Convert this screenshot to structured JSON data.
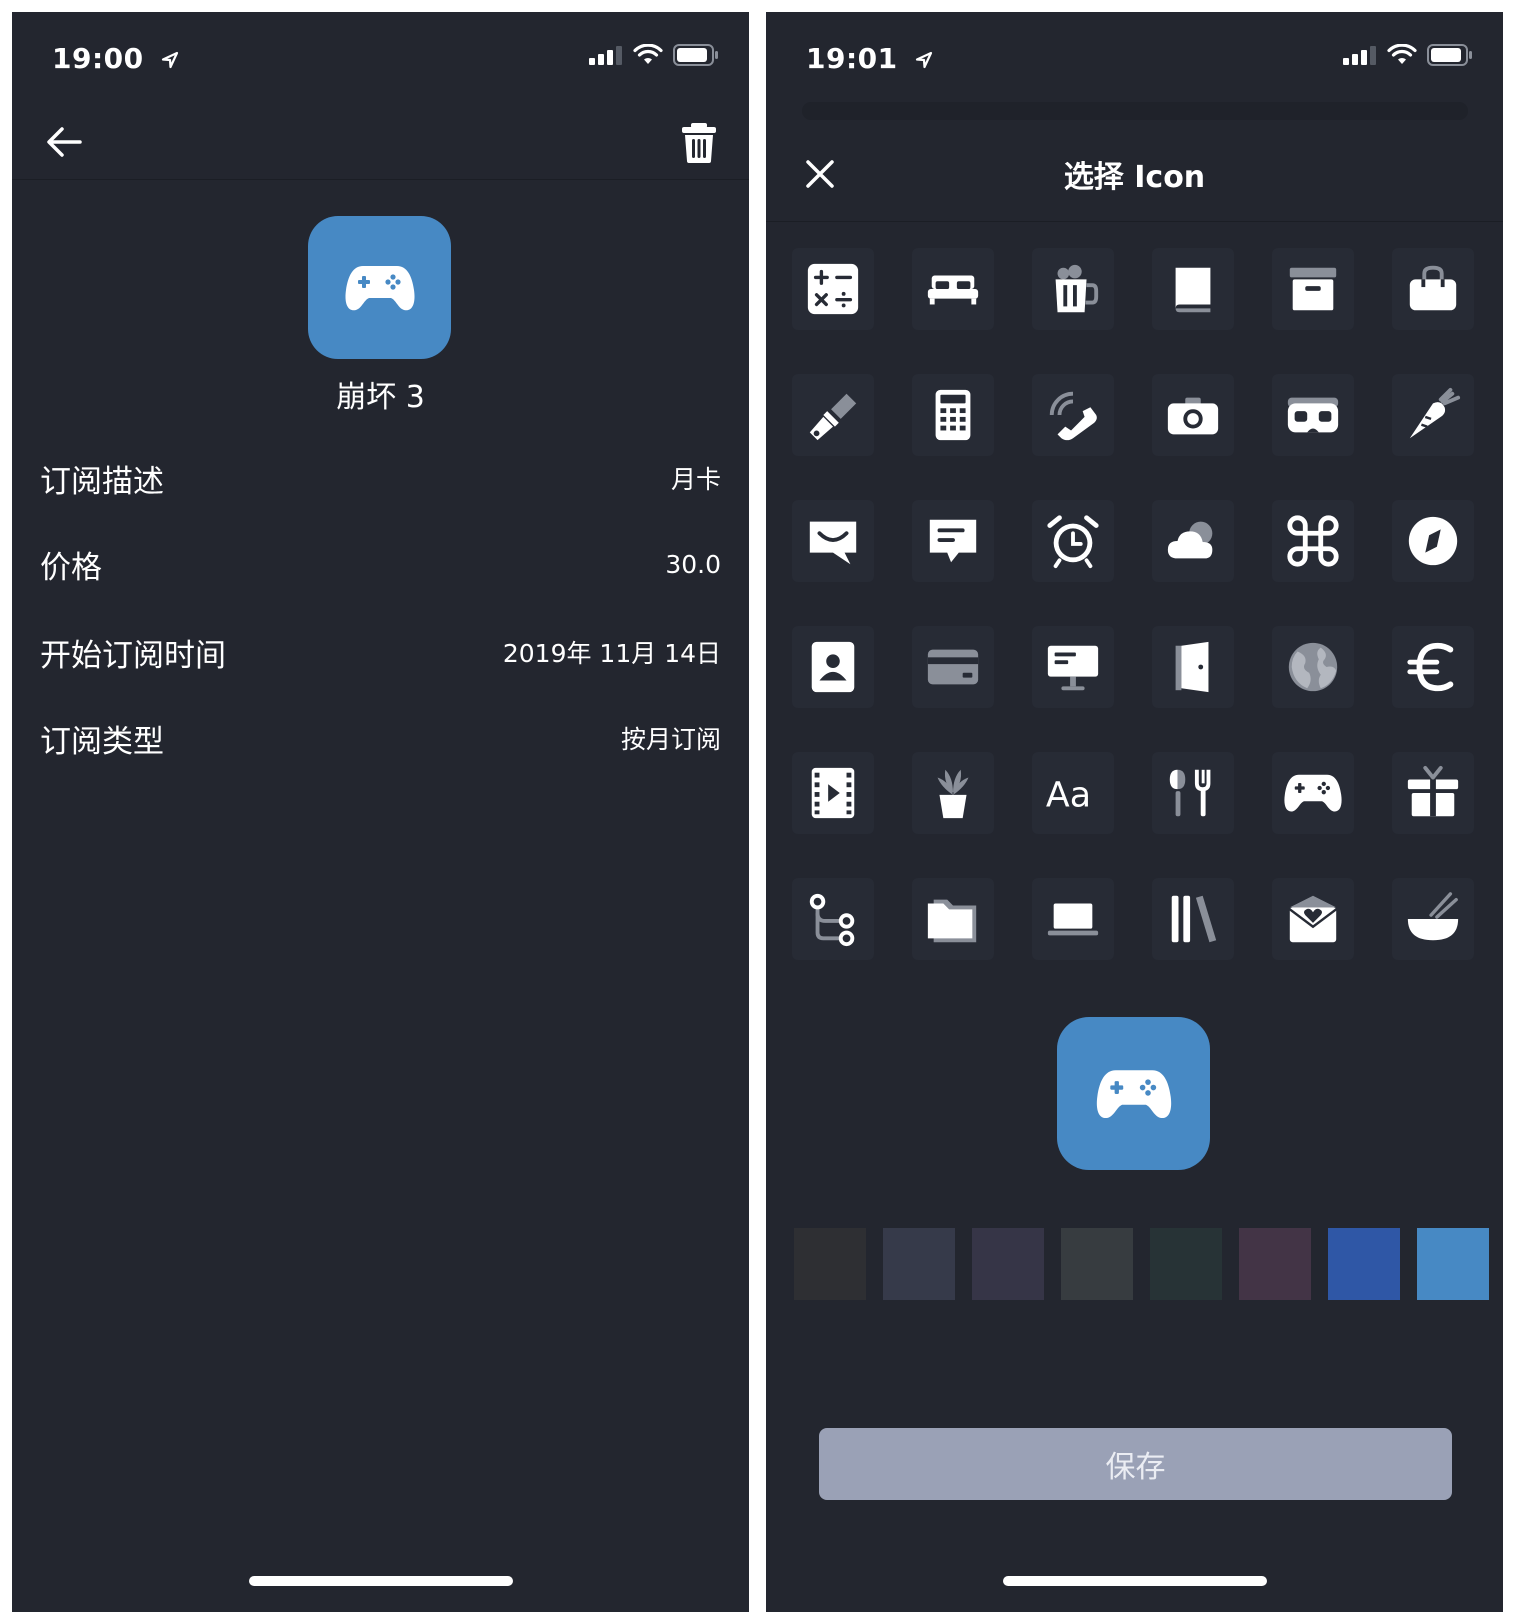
{
  "left_screen": {
    "status_time": "19:00",
    "app_name": "崩坏 3",
    "details": [
      {
        "label": "订阅描述",
        "value": "月卡"
      },
      {
        "label": "价格",
        "value": "30.0"
      },
      {
        "label": "开始订阅时间",
        "value": "2019年 11月 14日"
      },
      {
        "label": "订阅类型",
        "value": "按月订阅"
      }
    ],
    "icon_color": "#4789c4"
  },
  "right_screen": {
    "status_time": "19:01",
    "title": "选择 Icon",
    "icons": [
      "calculator-icon",
      "bed-icon",
      "beer-mug-icon",
      "book-icon",
      "archive-box-icon",
      "shopping-bag-icon",
      "paint-brush-icon",
      "calculator-pad-icon",
      "phone-ringing-icon",
      "camera-icon",
      "vr-headset-icon",
      "carrot-icon",
      "chat-smile-icon",
      "chat-message-icon",
      "alarm-clock-icon",
      "cloud-icon",
      "command-key-icon",
      "compass-icon",
      "contact-card-icon",
      "credit-card-icon",
      "desktop-monitor-icon",
      "door-icon",
      "globe-icon",
      "euro-icon",
      "film-icon",
      "plant-pot-icon",
      "font-icon",
      "utensils-icon",
      "gamepad-icon",
      "gift-icon",
      "git-branch-icon",
      "folder-icon",
      "laptop-icon",
      "library-books-icon",
      "love-letter-icon",
      "rice-bowl-icon"
    ],
    "font_icon_text": "Aa",
    "selected_icon": "gamepad-icon",
    "colors": [
      "#2e2f33",
      "#363a4a",
      "#363547",
      "#373c40",
      "#273336",
      "#433446",
      "#2f57a6",
      "#4789c4"
    ],
    "selected_color": "#4789c4",
    "save_label": "保存"
  }
}
